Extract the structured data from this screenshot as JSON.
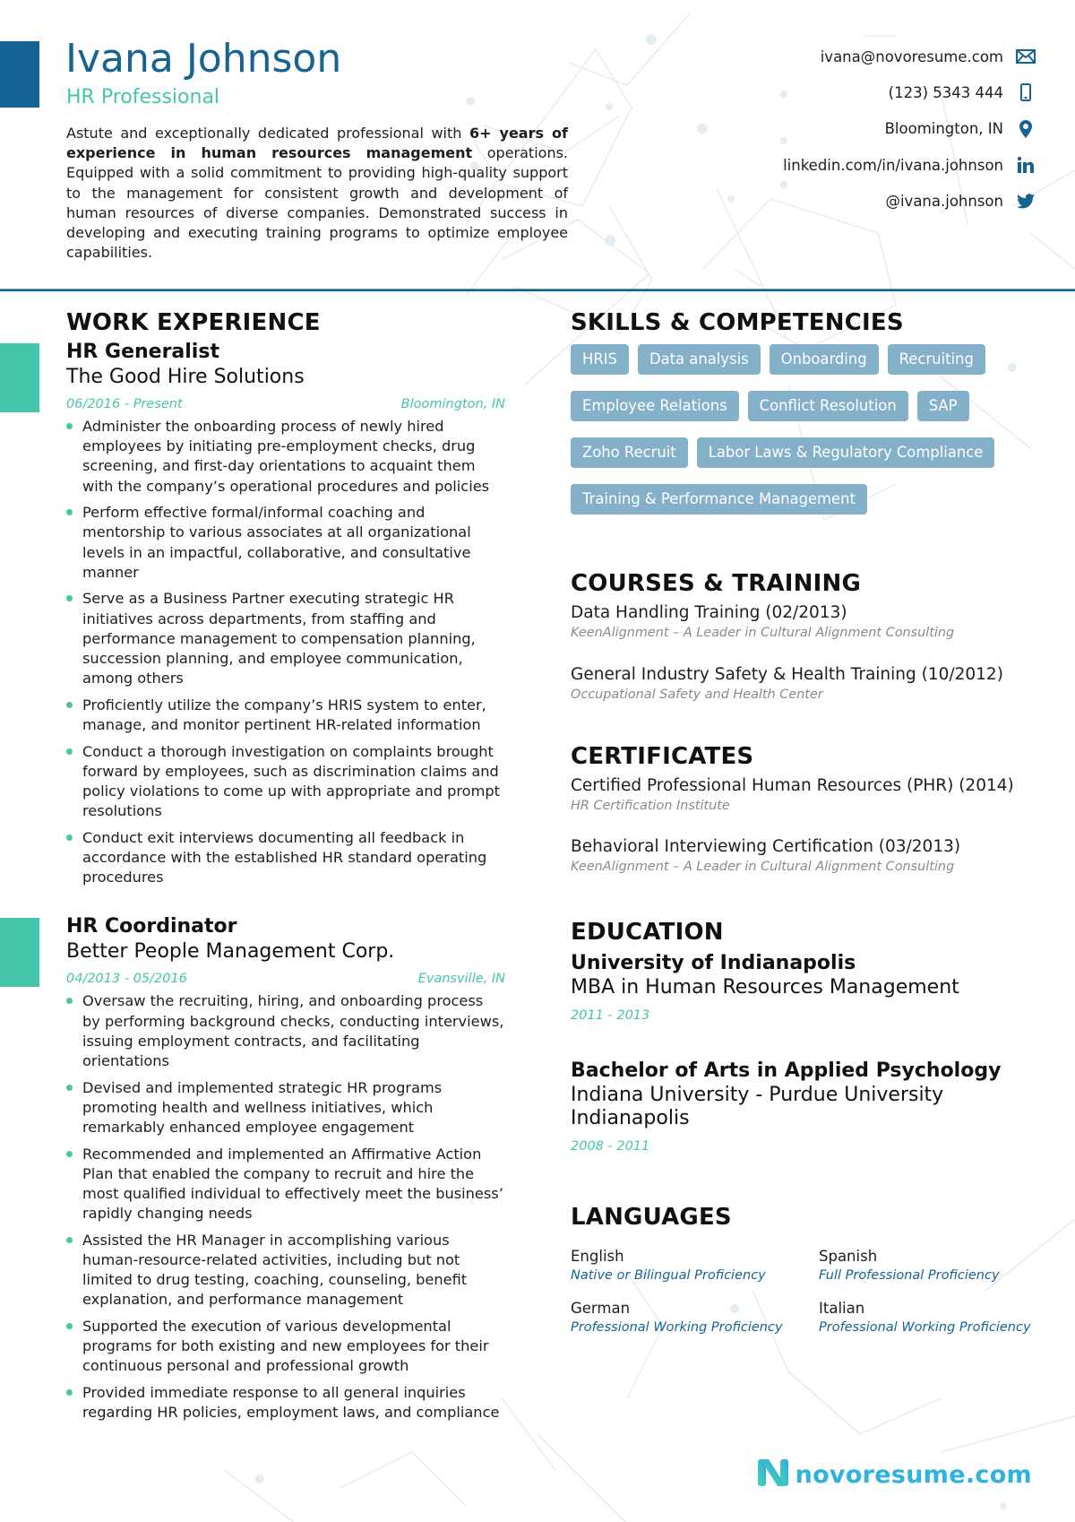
{
  "header": {
    "name": "Ivana Johnson",
    "title": "HR Professional",
    "summary": {
      "part1": "Astute and exceptionally dedicated professional with ",
      "bold": "6+ years of experience in human resources management",
      "part2": " operations. Equipped with a solid commitment to providing high-quality support to the management for consistent growth and development of human resources of diverse companies. Demonstrated success in developing and executing training programs to optimize employee capabilities."
    }
  },
  "contacts": [
    {
      "text": "ivana@novoresume.com",
      "icon": "envelope-icon"
    },
    {
      "text": "(123) 5343 444",
      "icon": "phone-icon"
    },
    {
      "text": "Bloomington, IN",
      "icon": "location-pin-icon"
    },
    {
      "text": "linkedin.com/in/ivana.johnson",
      "icon": "linkedin-icon"
    },
    {
      "text": "@ivana.johnson",
      "icon": "twitter-icon"
    }
  ],
  "colors": {
    "primary": "#156293",
    "accent": "#45c6aa",
    "skill_tag": "#84b0c9",
    "logo": "#2fb2dd"
  },
  "work": {
    "heading": "WORK EXPERIENCE",
    "jobs": [
      {
        "title": "HR Generalist",
        "company": "The Good Hire Solutions",
        "dates": "06/2016 - Present",
        "location": "Bloomington, IN",
        "bullets": [
          "Administer the onboarding process of newly hired employees by initiating pre-employment checks, drug screening, and first-day orientations to acquaint them with the company’s operational procedures and policies",
          "Perform effective formal/informal coaching and mentorship to various associates at all organizational levels in an impactful, collaborative, and consultative manner",
          "Serve as a Business Partner executing strategic HR initiatives across departments, from staffing and performance management to compensation planning, succession planning, and employee communication, among others",
          "Proficiently utilize the company’s HRIS system to enter, manage, and monitor pertinent HR-related information",
          "Conduct a thorough investigation on complaints brought forward by employees, such as discrimination claims and policy violations to come up with appropriate and prompt resolutions",
          "Conduct exit interviews documenting all feedback in accordance with the established HR standard operating procedures"
        ]
      },
      {
        "title": "HR Coordinator",
        "company": "Better People Management Corp.",
        "dates": "04/2013 - 05/2016",
        "location": "Evansville, IN",
        "bullets": [
          "Oversaw the recruiting, hiring, and onboarding process by performing background checks, conducting interviews, issuing employment contracts, and facilitating orientations",
          "Devised and implemented strategic HR programs promoting health and wellness initiatives, which remarkably enhanced employee engagement",
          "Recommended and implemented an Affirmative Action Plan that enabled the company to recruit and hire the most qualified individual to effectively meet the business’ rapidly changing needs",
          "Assisted the HR Manager in accomplishing various human-resource-related activities, including but not limited to drug testing, coaching, counseling, benefit explanation, and performance management",
          "Supported the execution of various developmental programs for both existing and new employees for their continuous personal and professional growth",
          "Provided immediate response to all general inquiries regarding HR policies, employment laws, and compliance"
        ]
      }
    ]
  },
  "skills": {
    "heading": "SKILLS & COMPETENCIES",
    "items": [
      "HRIS",
      "Data analysis",
      "Onboarding",
      "Recruiting",
      "Employee Relations",
      "Conflict Resolution",
      "SAP",
      "Zoho Recruit",
      "Labor Laws & Regulatory Compliance",
      "Training & Performance Management"
    ]
  },
  "courses": {
    "heading": "COURSES & TRAINING",
    "items": [
      {
        "title": "Data Handling Training (02/2013)",
        "org": "KeenAlignment – A Leader in Cultural Alignment Consulting"
      },
      {
        "title": "General Industry Safety & Health Training (10/2012)",
        "org": "Occupational Safety and Health Center"
      }
    ]
  },
  "certificates": {
    "heading": "CERTIFICATES",
    "items": [
      {
        "title": "Certified Professional Human Resources (PHR) (2014)",
        "org": "HR Certification Institute"
      },
      {
        "title": "Behavioral Interviewing Certification (03/2013)",
        "org": "KeenAlignment – A Leader in Cultural Alignment Consulting"
      }
    ]
  },
  "education": {
    "heading": "EDUCATION",
    "items": [
      {
        "school": "University of Indianapolis",
        "degree": "MBA in Human Resources Management",
        "dates": "2011 - 2013"
      },
      {
        "school": "Bachelor of Arts in Applied Psychology",
        "degree": "Indiana University - Purdue University Indianapolis",
        "dates": "2008 - 2011"
      }
    ]
  },
  "languages": {
    "heading": "LANGUAGES",
    "items": [
      {
        "name": "English",
        "level": "Native or Bilingual Proficiency"
      },
      {
        "name": "Spanish",
        "level": "Full Professional Proficiency"
      },
      {
        "name": "German",
        "level": "Professional Working Proficiency"
      },
      {
        "name": "Italian",
        "level": "Professional Working Proficiency"
      }
    ]
  },
  "footer": {
    "logo_text": "novoresume.com"
  }
}
